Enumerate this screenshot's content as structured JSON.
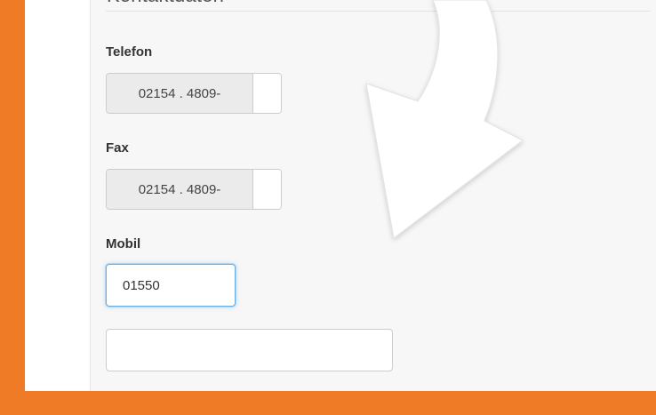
{
  "section": {
    "title": "Kontaktdaten"
  },
  "fields": {
    "telefon": {
      "label": "Telefon",
      "prefix": "02154 . 4809-",
      "value": ""
    },
    "fax": {
      "label": "Fax",
      "prefix": "02154 . 4809-",
      "value": ""
    },
    "mobil": {
      "label": "Mobil",
      "value": "01550"
    },
    "extra": {
      "value": ""
    }
  },
  "colors": {
    "frame": "#EF7B26",
    "panel": "#F7F7F7",
    "focus": "#66AFE9",
    "arrow": "#FFFFFF"
  },
  "icons": {
    "pointer": "curved-arrow-icon"
  }
}
